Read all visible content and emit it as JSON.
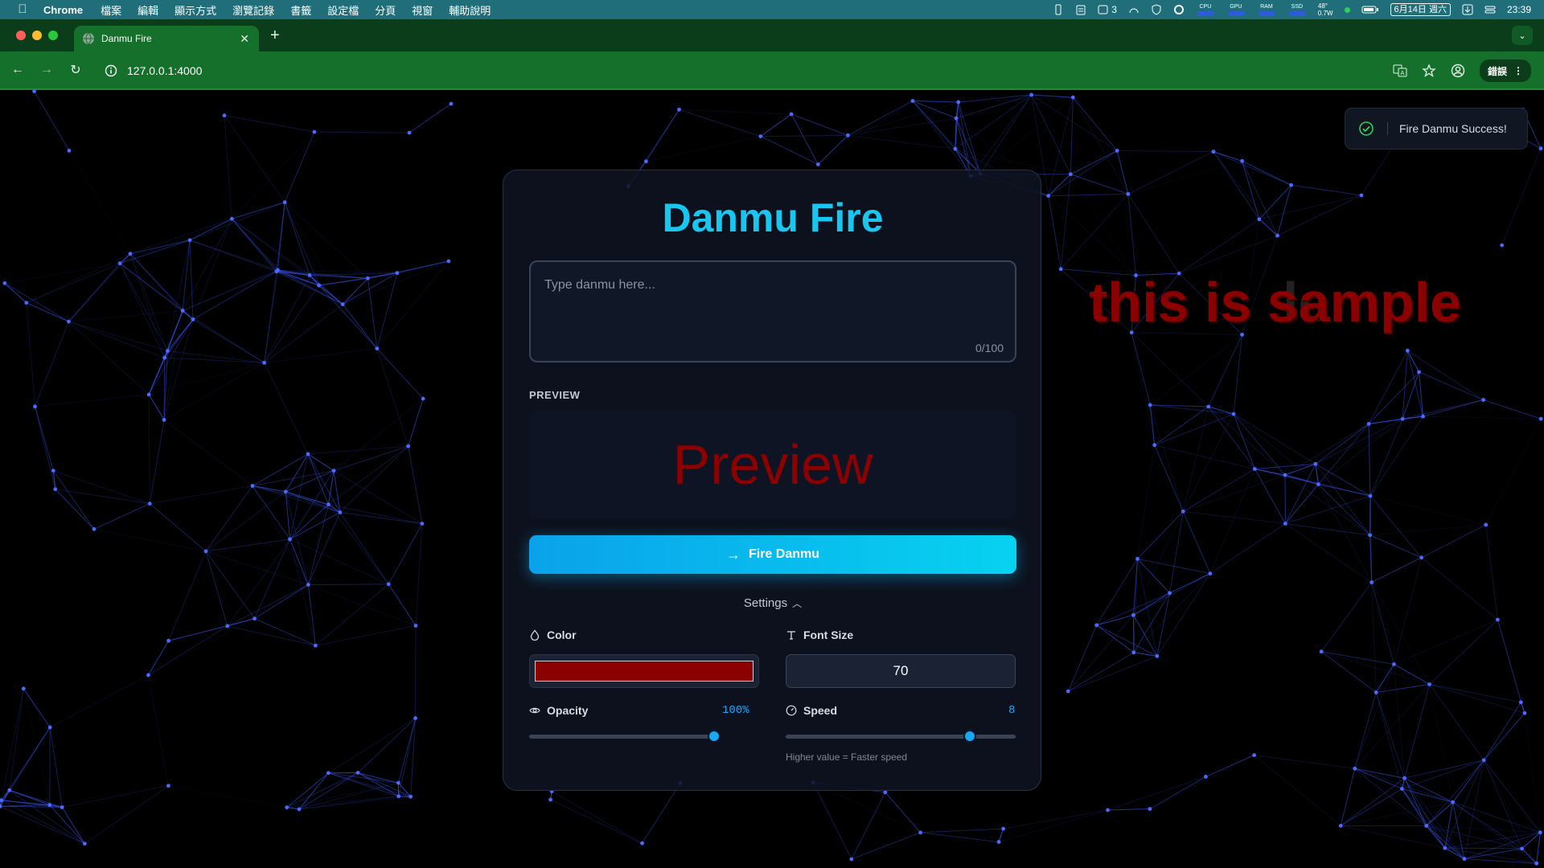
{
  "menubar": {
    "app": "Chrome",
    "items": [
      "檔案",
      "編輯",
      "顯示方式",
      "瀏覽記錄",
      "書籤",
      "設定檔",
      "分頁",
      "視窗",
      "輔助說明"
    ],
    "status_count": "3",
    "meters": [
      "CPU",
      "GPU",
      "RAM",
      "SSD"
    ],
    "temp": "48°",
    "power": "0.7W",
    "date": "6月14日 週六",
    "time": "23:39"
  },
  "browser": {
    "tab_title": "Danmu Fire",
    "url": "127.0.0.1:4000",
    "error_label": "錯誤"
  },
  "app": {
    "title": "Danmu Fire",
    "input_placeholder": "Type danmu here...",
    "char_count": "0/100",
    "preview_label": "PREVIEW",
    "preview_text": "Preview",
    "fire_button": "Fire Danmu",
    "settings_label": "Settings",
    "color_label": "Color",
    "color_value": "#8b0000",
    "font_size_label": "Font Size",
    "font_size_value": "70",
    "opacity_label": "Opacity",
    "opacity_value": "100%",
    "opacity_level": 1.0,
    "speed_label": "Speed",
    "speed_value": "8",
    "speed_level": 0.8,
    "speed_hint": "Higher value = Faster speed"
  },
  "toast": {
    "message": "Fire Danmu Success!"
  },
  "danmu": {
    "text": "this is sample",
    "ghost_text": "le"
  },
  "colors": {
    "accent": "#18c6f0",
    "danmu": "#8b0000",
    "network": "#3b5bff"
  }
}
